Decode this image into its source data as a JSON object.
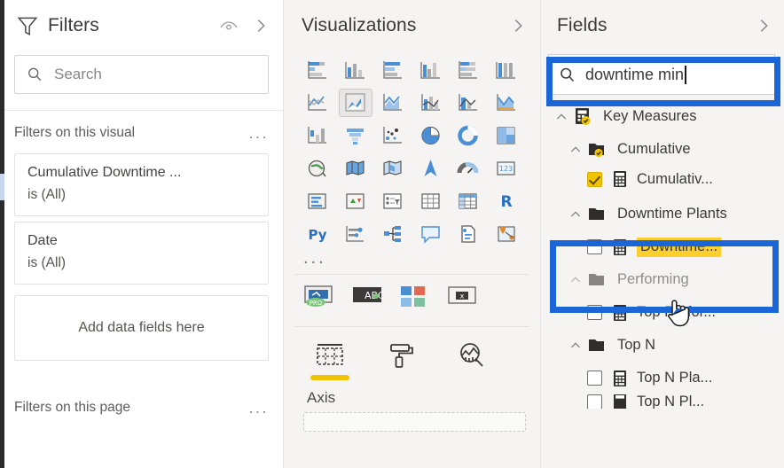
{
  "filters": {
    "title": "Filters",
    "icons": {
      "funnel": "funnel-icon",
      "hide": "eye-hide-icon",
      "expand": "chevron-right-icon"
    },
    "search": {
      "placeholder": "Search",
      "icon": "search-icon"
    },
    "visual_section": {
      "label": "Filters on this visual",
      "more": "..."
    },
    "cards": [
      {
        "title": "Cumulative Downtime ...",
        "value": "is (All)"
      },
      {
        "title": "Date",
        "value": "is (All)"
      }
    ],
    "dropzone": "Add data fields here",
    "page_section": {
      "label": "Filters on this page",
      "more": "..."
    }
  },
  "visualizations": {
    "title": "Visualizations",
    "expand_icon": "chevron-right-icon",
    "gallery": [
      "stacked-bar-chart-icon",
      "stacked-column-chart-icon",
      "clustered-bar-chart-icon",
      "clustered-column-chart-icon",
      "100-stacked-bar-chart-icon",
      "100-stacked-column-chart-icon",
      "line-chart-icon",
      "area-chart-icon",
      "stacked-area-chart-icon",
      "line-and-stacked-column-chart-icon",
      "line-and-clustered-column-chart-icon",
      "ribbon-chart-icon",
      "waterfall-chart-icon",
      "funnel-chart-icon",
      "scatter-chart-icon",
      "pie-chart-icon",
      "donut-chart-icon",
      "treemap-icon",
      "map-icon",
      "filled-map-icon",
      "shape-map-icon",
      "arcgis-map-icon",
      "gauge-icon",
      "card-icon",
      "multi-row-card-icon",
      "kpi-icon",
      "slicer-icon",
      "table-icon",
      "matrix-icon",
      "r-script-visual-icon",
      "python-visual-icon",
      "key-influencers-icon",
      "decomposition-tree-icon",
      "qa-visual-icon",
      "paginated-report-icon",
      "power-apps-icon"
    ],
    "gallery_more": "...",
    "custom_visuals": [
      "zoomcharts-pro-icon",
      "abc-text-visual-icon",
      "color-tiles-icon",
      "import-visual-icon"
    ],
    "format_tabs": [
      {
        "name": "fields-tab",
        "icon": "fields-pane-icon",
        "selected": true
      },
      {
        "name": "format-tab",
        "icon": "paint-roller-icon",
        "selected": false
      },
      {
        "name": "analytics-tab",
        "icon": "analytics-magnifier-icon",
        "selected": false
      }
    ],
    "well_label": "Axis"
  },
  "fields": {
    "title": "Fields",
    "expand_icon": "chevron-right-icon",
    "search": {
      "value": "downtime min",
      "icon": "search-icon"
    },
    "tree": [
      {
        "level": 1,
        "type": "table",
        "icon": "table-measure-icon",
        "chevron": "chevron-up-icon",
        "label": "Key Measures",
        "badge": true
      },
      {
        "level": 2,
        "type": "folder",
        "icon": "folder-icon",
        "chevron": "chevron-up-icon",
        "label": "Cumulative",
        "badge": true
      },
      {
        "level": 3,
        "type": "measure",
        "icon": "calculator-icon",
        "label": "Cumulativ...",
        "checked": true,
        "clipped": true
      },
      {
        "level": 2,
        "type": "folder",
        "icon": "folder-icon",
        "chevron": "chevron-up-icon",
        "label": "Downtime Plants",
        "badge": false
      },
      {
        "level": 3,
        "type": "measure",
        "icon": "calculator-icon",
        "label": "Downtime...",
        "checked": false,
        "highlight": true
      },
      {
        "level": 2,
        "type": "folder",
        "icon": "folder-icon",
        "chevron": "chevron-up-icon",
        "label": "Performing",
        "badge": false,
        "obscured": true
      },
      {
        "level": 3,
        "type": "measure",
        "icon": "calculator-icon",
        "label": "Top Perfor...",
        "checked": false
      },
      {
        "level": 2,
        "type": "folder",
        "icon": "folder-icon",
        "chevron": "chevron-up-icon",
        "label": "Top N",
        "badge": false
      },
      {
        "level": 3,
        "type": "measure",
        "icon": "calculator-icon",
        "label": "Top N Pla...",
        "checked": false
      },
      {
        "level": 3,
        "type": "measure",
        "icon": "calculator-icon",
        "label": "Top N Pl...",
        "checked": false,
        "clipped": true
      }
    ]
  },
  "annotations": {
    "search_box_highlight": {
      "color": "#1a66d6",
      "name": "search-box-annotation"
    },
    "field_item_highlight": {
      "color": "#1a66d6",
      "name": "field-item-annotation"
    },
    "cursor": "hand-pointer-cursor"
  },
  "colors": {
    "accent_blue": "#1a66d6",
    "highlight_yellow": "#fbd02e",
    "tab_underline": "#f2c300",
    "panel_bg": "#f5f4f3",
    "white": "#ffffff"
  }
}
